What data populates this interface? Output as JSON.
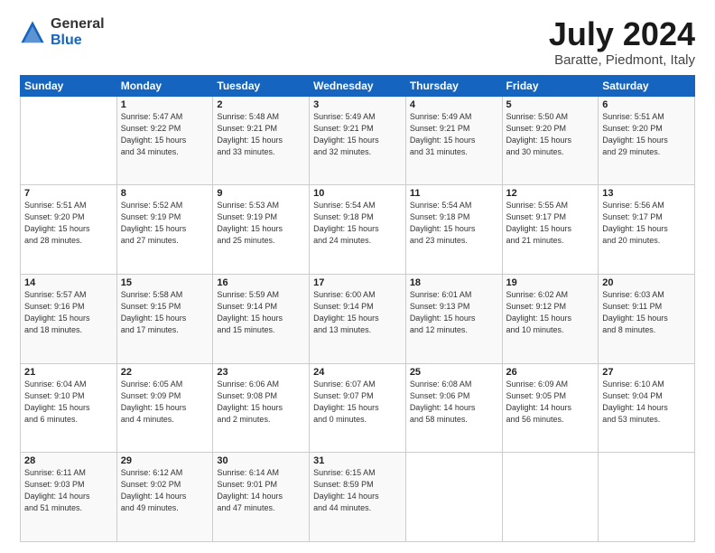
{
  "logo": {
    "general": "General",
    "blue": "Blue"
  },
  "title": "July 2024",
  "subtitle": "Baratte, Piedmont, Italy",
  "days_of_week": [
    "Sunday",
    "Monday",
    "Tuesday",
    "Wednesday",
    "Thursday",
    "Friday",
    "Saturday"
  ],
  "weeks": [
    [
      {
        "day": "",
        "info": ""
      },
      {
        "day": "1",
        "info": "Sunrise: 5:47 AM\nSunset: 9:22 PM\nDaylight: 15 hours\nand 34 minutes."
      },
      {
        "day": "2",
        "info": "Sunrise: 5:48 AM\nSunset: 9:21 PM\nDaylight: 15 hours\nand 33 minutes."
      },
      {
        "day": "3",
        "info": "Sunrise: 5:49 AM\nSunset: 9:21 PM\nDaylight: 15 hours\nand 32 minutes."
      },
      {
        "day": "4",
        "info": "Sunrise: 5:49 AM\nSunset: 9:21 PM\nDaylight: 15 hours\nand 31 minutes."
      },
      {
        "day": "5",
        "info": "Sunrise: 5:50 AM\nSunset: 9:20 PM\nDaylight: 15 hours\nand 30 minutes."
      },
      {
        "day": "6",
        "info": "Sunrise: 5:51 AM\nSunset: 9:20 PM\nDaylight: 15 hours\nand 29 minutes."
      }
    ],
    [
      {
        "day": "7",
        "info": "Sunrise: 5:51 AM\nSunset: 9:20 PM\nDaylight: 15 hours\nand 28 minutes."
      },
      {
        "day": "8",
        "info": "Sunrise: 5:52 AM\nSunset: 9:19 PM\nDaylight: 15 hours\nand 27 minutes."
      },
      {
        "day": "9",
        "info": "Sunrise: 5:53 AM\nSunset: 9:19 PM\nDaylight: 15 hours\nand 25 minutes."
      },
      {
        "day": "10",
        "info": "Sunrise: 5:54 AM\nSunset: 9:18 PM\nDaylight: 15 hours\nand 24 minutes."
      },
      {
        "day": "11",
        "info": "Sunrise: 5:54 AM\nSunset: 9:18 PM\nDaylight: 15 hours\nand 23 minutes."
      },
      {
        "day": "12",
        "info": "Sunrise: 5:55 AM\nSunset: 9:17 PM\nDaylight: 15 hours\nand 21 minutes."
      },
      {
        "day": "13",
        "info": "Sunrise: 5:56 AM\nSunset: 9:17 PM\nDaylight: 15 hours\nand 20 minutes."
      }
    ],
    [
      {
        "day": "14",
        "info": "Sunrise: 5:57 AM\nSunset: 9:16 PM\nDaylight: 15 hours\nand 18 minutes."
      },
      {
        "day": "15",
        "info": "Sunrise: 5:58 AM\nSunset: 9:15 PM\nDaylight: 15 hours\nand 17 minutes."
      },
      {
        "day": "16",
        "info": "Sunrise: 5:59 AM\nSunset: 9:14 PM\nDaylight: 15 hours\nand 15 minutes."
      },
      {
        "day": "17",
        "info": "Sunrise: 6:00 AM\nSunset: 9:14 PM\nDaylight: 15 hours\nand 13 minutes."
      },
      {
        "day": "18",
        "info": "Sunrise: 6:01 AM\nSunset: 9:13 PM\nDaylight: 15 hours\nand 12 minutes."
      },
      {
        "day": "19",
        "info": "Sunrise: 6:02 AM\nSunset: 9:12 PM\nDaylight: 15 hours\nand 10 minutes."
      },
      {
        "day": "20",
        "info": "Sunrise: 6:03 AM\nSunset: 9:11 PM\nDaylight: 15 hours\nand 8 minutes."
      }
    ],
    [
      {
        "day": "21",
        "info": "Sunrise: 6:04 AM\nSunset: 9:10 PM\nDaylight: 15 hours\nand 6 minutes."
      },
      {
        "day": "22",
        "info": "Sunrise: 6:05 AM\nSunset: 9:09 PM\nDaylight: 15 hours\nand 4 minutes."
      },
      {
        "day": "23",
        "info": "Sunrise: 6:06 AM\nSunset: 9:08 PM\nDaylight: 15 hours\nand 2 minutes."
      },
      {
        "day": "24",
        "info": "Sunrise: 6:07 AM\nSunset: 9:07 PM\nDaylight: 15 hours\nand 0 minutes."
      },
      {
        "day": "25",
        "info": "Sunrise: 6:08 AM\nSunset: 9:06 PM\nDaylight: 14 hours\nand 58 minutes."
      },
      {
        "day": "26",
        "info": "Sunrise: 6:09 AM\nSunset: 9:05 PM\nDaylight: 14 hours\nand 56 minutes."
      },
      {
        "day": "27",
        "info": "Sunrise: 6:10 AM\nSunset: 9:04 PM\nDaylight: 14 hours\nand 53 minutes."
      }
    ],
    [
      {
        "day": "28",
        "info": "Sunrise: 6:11 AM\nSunset: 9:03 PM\nDaylight: 14 hours\nand 51 minutes."
      },
      {
        "day": "29",
        "info": "Sunrise: 6:12 AM\nSunset: 9:02 PM\nDaylight: 14 hours\nand 49 minutes."
      },
      {
        "day": "30",
        "info": "Sunrise: 6:14 AM\nSunset: 9:01 PM\nDaylight: 14 hours\nand 47 minutes."
      },
      {
        "day": "31",
        "info": "Sunrise: 6:15 AM\nSunset: 8:59 PM\nDaylight: 14 hours\nand 44 minutes."
      },
      {
        "day": "",
        "info": ""
      },
      {
        "day": "",
        "info": ""
      },
      {
        "day": "",
        "info": ""
      }
    ]
  ]
}
